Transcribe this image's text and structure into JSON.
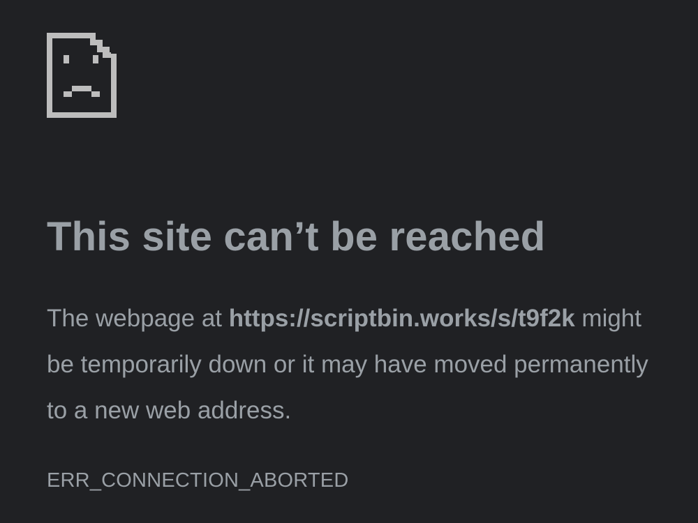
{
  "error": {
    "icon": "sad-page-icon",
    "title": "This site can’t be reached",
    "message_prefix": "The webpage at ",
    "url": "https://scriptbin.works/s/t9f2k",
    "message_suffix": " might be temporarily down or it may have moved permanently to a new web address.",
    "code": "ERR_CONNECTION_ABORTED"
  },
  "colors": {
    "background": "#202124",
    "text": "#9aa0a6",
    "icon": "#bdbdbd"
  }
}
